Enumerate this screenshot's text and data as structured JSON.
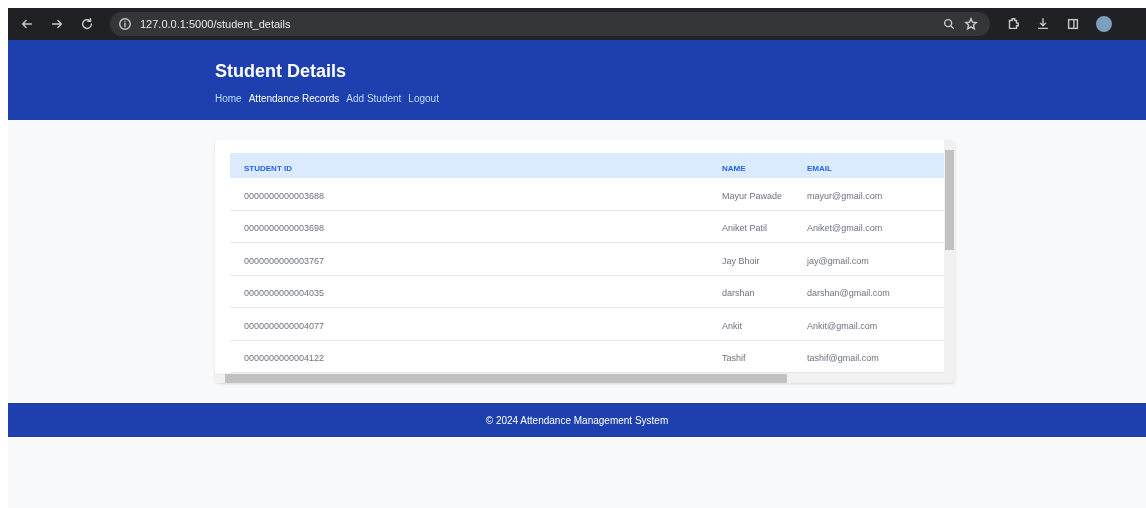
{
  "browser": {
    "url": "127.0.0.1:5000/student_details"
  },
  "header": {
    "title": "Student Details",
    "nav": [
      {
        "label": "Home",
        "selected": false
      },
      {
        "label": "Attendance Records",
        "selected": true
      },
      {
        "label": "Add Student",
        "selected": false
      },
      {
        "label": "Logout",
        "selected": false
      }
    ]
  },
  "table": {
    "columns": [
      "STUDENT ID",
      "NAME",
      "EMAIL"
    ],
    "rows": [
      [
        "0000000000003688",
        "Mayur Pawade",
        "mayur@gmail.com"
      ],
      [
        "0000000000003698",
        "Aniket Patil",
        "Aniket@gmail.com"
      ],
      [
        "0000000000003767",
        "Jay Bhoir",
        "jay@gmail.com"
      ],
      [
        "0000000000004035",
        "darshan",
        "darshan@gmail.com"
      ],
      [
        "0000000000004077",
        "Ankit",
        "Ankit@gmail.com"
      ],
      [
        "0000000000004122",
        "Tashif",
        "tashif@gmail.com"
      ]
    ]
  },
  "footer": {
    "text": "© 2024 Attendance Management System"
  }
}
